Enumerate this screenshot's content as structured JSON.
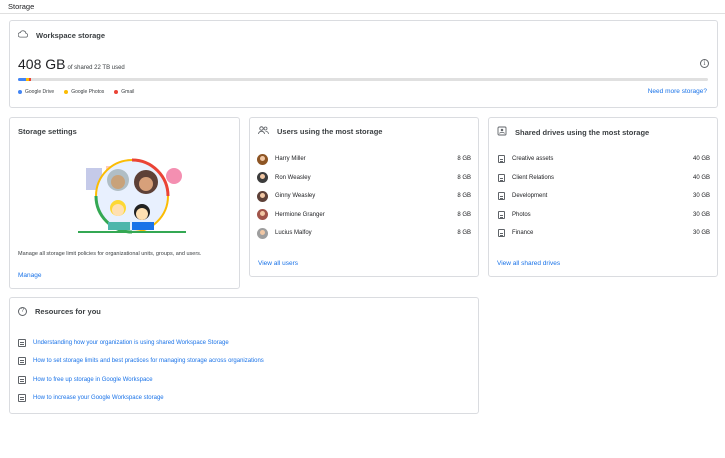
{
  "page": {
    "title": "Storage"
  },
  "workspace_storage": {
    "title": "Workspace storage",
    "used_value": "408 GB",
    "used_caption": "of shared 22 TB used",
    "legend": [
      {
        "label": "Google Drive",
        "color": "#4285f4",
        "fraction": 0.012
      },
      {
        "label": "Google Photos",
        "color": "#fbbc04",
        "fraction": 0.004
      },
      {
        "label": "Gmail",
        "color": "#ea4335",
        "fraction": 0.003
      }
    ],
    "more_link": "Need more storage?"
  },
  "storage_settings": {
    "title": "Storage settings",
    "description": "Manage all storage limit policies for organizational units, groups, and users.",
    "manage_link": "Manage"
  },
  "users": {
    "title": "Users using the most storage",
    "rows": [
      {
        "name": "Harry Miller",
        "value": "8 GB",
        "color": "#8d5524"
      },
      {
        "name": "Ron Weasley",
        "value": "8 GB",
        "color": "#3c3c3c"
      },
      {
        "name": "Ginny Weasley",
        "value": "8 GB",
        "color": "#5d4037"
      },
      {
        "name": "Hermione Granger",
        "value": "8 GB",
        "color": "#a1544a"
      },
      {
        "name": "Lucius Malfoy",
        "value": "8 GB",
        "color": "#9e9e9e"
      }
    ],
    "link": "View all users"
  },
  "shared_drives": {
    "title": "Shared drives using the most storage",
    "rows": [
      {
        "name": "Creative assets",
        "value": "40 GB"
      },
      {
        "name": "Client Relations",
        "value": "40 GB"
      },
      {
        "name": "Development",
        "value": "30 GB"
      },
      {
        "name": "Photos",
        "value": "30 GB"
      },
      {
        "name": "Finance",
        "value": "30 GB"
      }
    ],
    "link": "View all shared drives"
  },
  "resources": {
    "title": "Resources for you",
    "links": [
      "Understanding how your organization is using shared Workspace Storage",
      "How to set storage limits and best practices for managing storage across organizations",
      "How to free up storage in Google Workspace",
      "How to increase your Google Workspace storage"
    ]
  }
}
